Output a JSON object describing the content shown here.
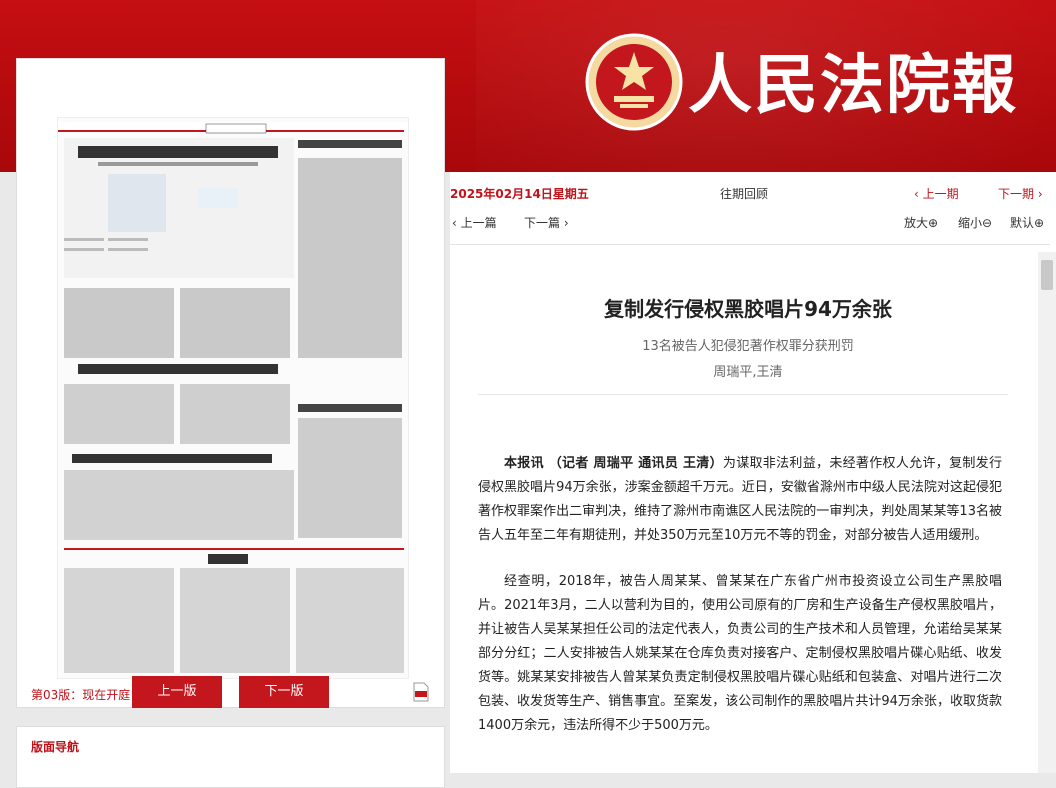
{
  "masthead": {
    "brand": "人民法院報"
  },
  "paper_preview": {
    "page_label": "第03版：现在开庭",
    "prev_button": "上一版",
    "next_button": "下一版"
  },
  "nav_panel": {
    "title": "版面导航"
  },
  "issue_bar": {
    "date": "2025年02月14日星期五",
    "past_issues": "往期回顾",
    "prev_issue": "‹ 上一期",
    "next_issue": "下一期 ›"
  },
  "article_bar": {
    "prev_article": "‹ 上一篇",
    "next_article": "下一篇 ›",
    "zoom_in": "放大⊕",
    "zoom_out": "缩小⊖",
    "default": "默认⊕"
  },
  "article": {
    "title": "复制发行侵权黑胶唱片94万余张",
    "subtitle": "13名被告人犯侵犯著作权罪分获刑罚",
    "authors": "周瑞平,王清",
    "lead": "本报讯 （记者 周瑞平 通讯员 王清）",
    "p1": "为谋取非法利益，未经著作权人允许，复制发行侵权黑胶唱片94万余张，涉案金额超千万元。近日，安徽省滁州市中级人民法院对这起侵犯著作权罪案作出二审判决，维持了滁州市南谯区人民法院的一审判决，判处周某某等13名被告人五年至二年有期徒刑，并处350万元至10万元不等的罚金，对部分被告人适用缓刑。",
    "p2": "经查明，2018年，被告人周某某、曾某某在广东省广州市投资设立公司生产黑胶唱片。2021年3月，二人以营利为目的，使用公司原有的厂房和生产设备生产侵权黑胶唱片，并让被告人吴某某担任公司的法定代表人，负责公司的生产技术和人员管理，允诺给吴某某部分分红；二人安排被告人姚某某在仓库负责对接客户、定制侵权黑胶唱片碟心贴纸、收发货等。姚某某安排被告人曾某某负责定制侵权黑胶唱片碟心贴纸和包装盒、对唱片进行二次包装、收发货等生产、销售事宜。至案发，该公司制作的黑胶唱片共计94万余张，收取货款1400万余元，违法所得不少于500万元。"
  },
  "colors": {
    "brand_red": "#c4161d",
    "banner_red": "#b40a0d"
  }
}
